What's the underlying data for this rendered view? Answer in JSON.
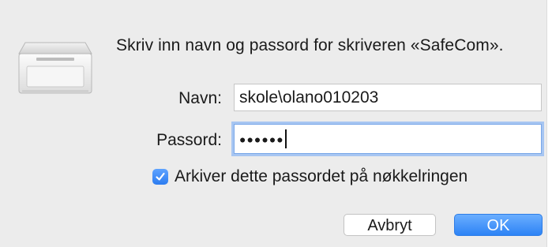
{
  "dialog": {
    "message": "Skriv inn navn og passord for skriveren «SafeCom».",
    "icon": "printer-icon"
  },
  "form": {
    "name_label": "Navn:",
    "name_value": "skole\\olano010203",
    "password_label": "Passord:",
    "password_mask": "●●●●●●",
    "remember_label": "Arkiver dette passordet på nøkkelringen",
    "remember_checked": true
  },
  "buttons": {
    "cancel_label": "Avbryt",
    "ok_label": "OK"
  },
  "colors": {
    "accent": "#2d83f5",
    "focus_ring": "#a7c6f2",
    "dialog_bg": "#ececec"
  }
}
